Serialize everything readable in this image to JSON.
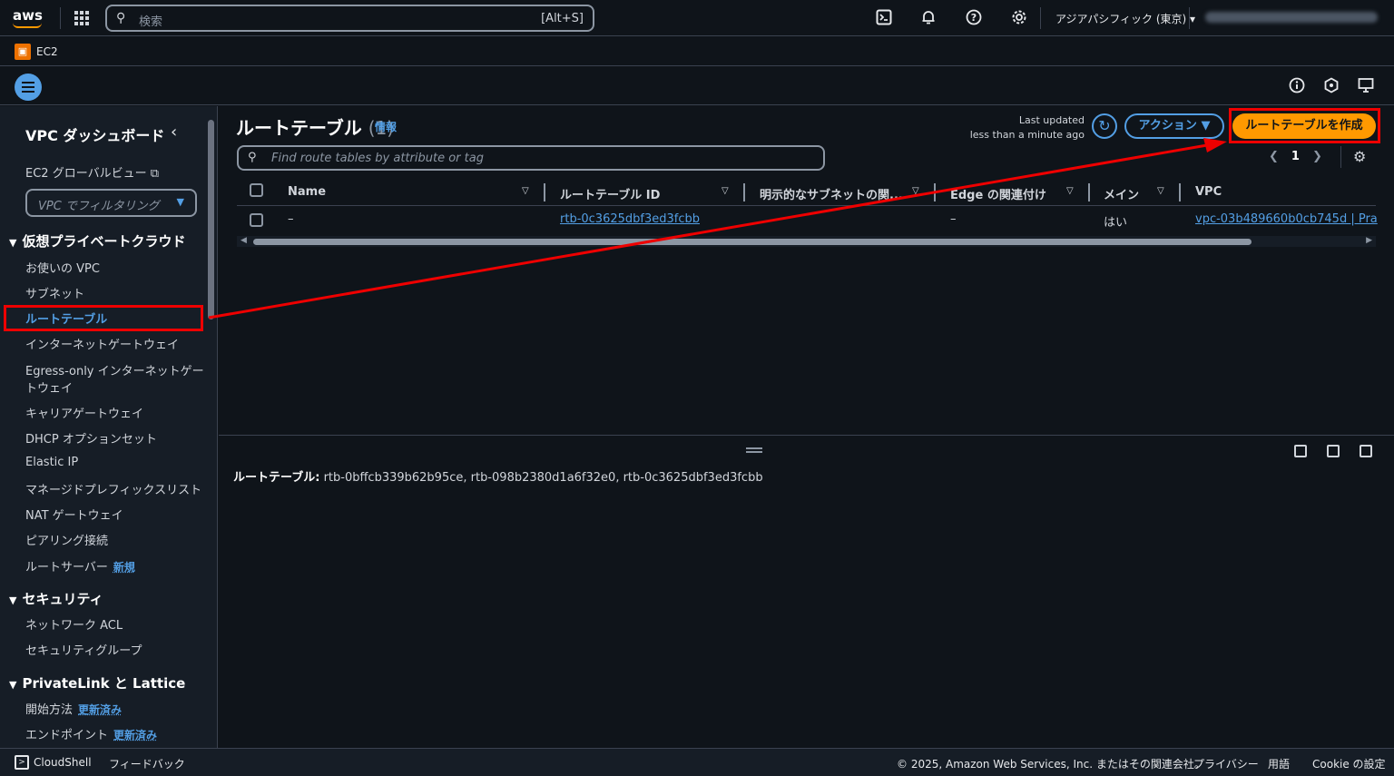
{
  "topbar": {
    "logo": "aws",
    "search_placeholder": "検索",
    "search_shortcut": "[Alt+S]",
    "region": "アジアパシフィック (東京) ▾"
  },
  "service": {
    "name": "EC2"
  },
  "sidebar": {
    "title": "VPC ダッシュボード",
    "global_view": "EC2 グローバルビュー",
    "filter_placeholder": "VPC でフィルタリング",
    "sections": [
      {
        "label": "仮想プライベートクラウド",
        "items": [
          "お使いの VPC",
          "サブネット",
          "ルートテーブル",
          "インターネットゲートウェイ",
          "Egress-only インターネットゲー",
          "トウェイ",
          "キャリアゲートウェイ",
          "DHCP オプションセット",
          "Elastic IP",
          "マネージドプレフィックスリスト",
          "NAT ゲートウェイ",
          "ピアリング接続",
          "ルートサーバー"
        ]
      },
      {
        "label": "セキュリティ",
        "items": [
          "ネットワーク ACL",
          "セキュリティグループ"
        ]
      },
      {
        "label": "PrivateLink と Lattice",
        "items": [
          "開始方法",
          "エンドポイント"
        ]
      }
    ],
    "badge_new": "新規",
    "badge_updated": "更新済み"
  },
  "main": {
    "title": "ルートテーブル",
    "count": "(1)",
    "info": "情報",
    "last_updated_line1": "Last updated",
    "last_updated_line2": "less than a minute ago",
    "actions_label": "アクション",
    "create_label": "ルートテーブルを作成",
    "search_placeholder": "Find route tables by attribute or tag",
    "page": "1",
    "columns": [
      "Name",
      "ルートテーブル ID",
      "明示的なサブネットの関...",
      "Edge の関連付け",
      "メイン",
      "VPC"
    ],
    "rows": [
      {
        "name": "–",
        "id": "rtb-0c3625dbf3ed3fcbb",
        "subnet": "",
        "edge": "–",
        "main": "はい",
        "vpc": "vpc-03b489660b0cb745d | Pra"
      }
    ]
  },
  "details": {
    "label": "ルートテーブル:",
    "value": "rtb-0bffcb339b62b95ce, rtb-098b2380d1a6f32e0, rtb-0c3625dbf3ed3fcbb"
  },
  "footer": {
    "cloudshell": "CloudShell",
    "feedback": "フィードバック",
    "copyright": "© 2025, Amazon Web Services, Inc. またはその関連会社。",
    "privacy": "プライバシー",
    "terms": "用語",
    "cookie": "Cookie の設定"
  },
  "colors": {
    "accent": "#539fe5",
    "primary_button": "#ff9900",
    "annotation": "#ee0000"
  }
}
